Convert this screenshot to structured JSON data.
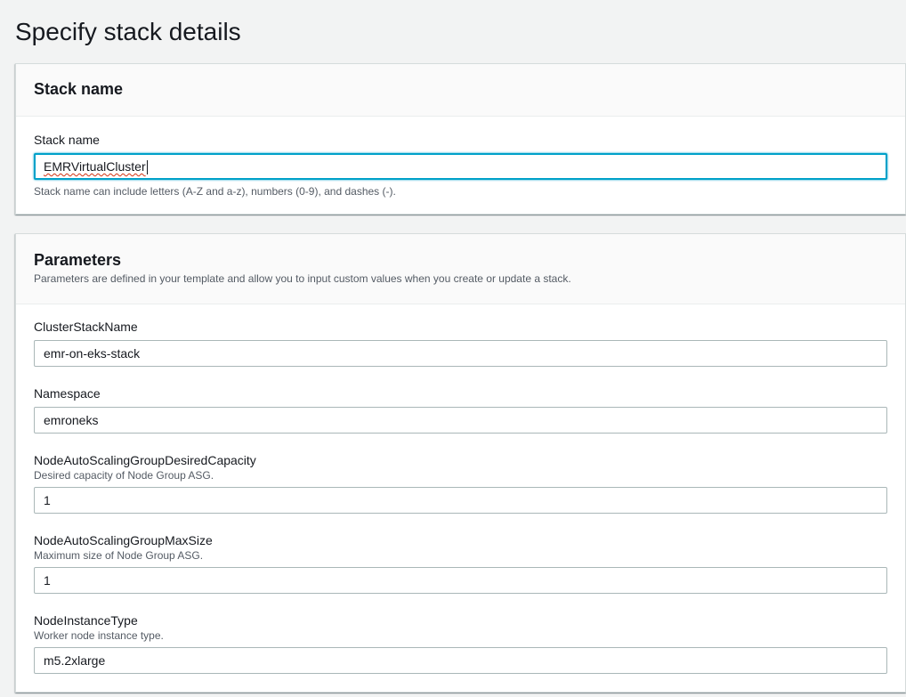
{
  "page": {
    "title": "Specify stack details"
  },
  "stack_name_panel": {
    "title": "Stack name",
    "field": {
      "label": "Stack name",
      "value": "EMRVirtualCluster",
      "hint": "Stack name can include letters (A-Z and a-z), numbers (0-9), and dashes (-)."
    }
  },
  "parameters_panel": {
    "title": "Parameters",
    "description": "Parameters are defined in your template and allow you to input custom values when you create or update a stack.",
    "fields": [
      {
        "label": "ClusterStackName",
        "description": "",
        "value": "emr-on-eks-stack"
      },
      {
        "label": "Namespace",
        "description": "",
        "value": "emroneks"
      },
      {
        "label": "NodeAutoScalingGroupDesiredCapacity",
        "description": "Desired capacity of Node Group ASG.",
        "value": "1"
      },
      {
        "label": "NodeAutoScalingGroupMaxSize",
        "description": "Maximum size of Node Group ASG.",
        "value": "1"
      },
      {
        "label": "NodeInstanceType",
        "description": "Worker node instance type.",
        "value": "m5.2xlarge"
      }
    ]
  },
  "colors": {
    "background": "#f2f3f3",
    "focus_border": "#00a1c9",
    "input_border": "#aab7b8",
    "hint_text": "#545b64"
  }
}
